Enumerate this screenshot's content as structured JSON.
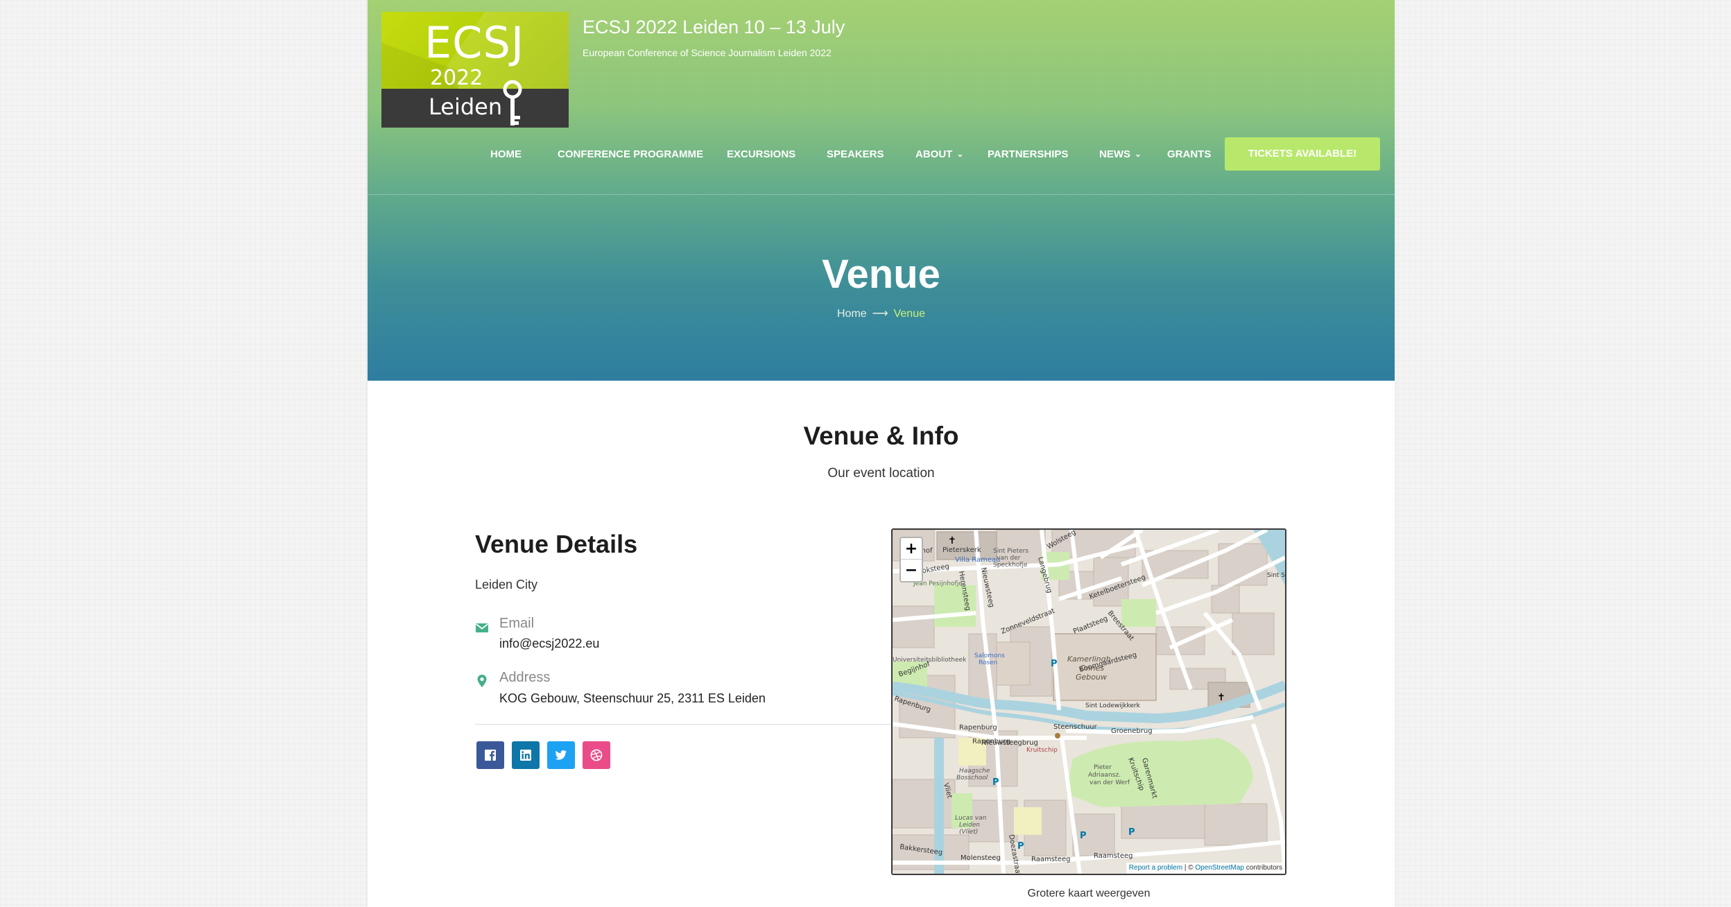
{
  "site": {
    "logo": {
      "line1": "ECSJ",
      "line2": "2022",
      "line3": "Leiden"
    },
    "title": "ECSJ 2022 Leiden 10 – 13 July",
    "tagline": "European Conference of Science Journalism Leiden 2022"
  },
  "nav": {
    "items": [
      {
        "label": "HOME",
        "dropdown": false
      },
      {
        "label": "CONFERENCE PROGRAMME",
        "dropdown": false
      },
      {
        "label": "EXCURSIONS",
        "dropdown": false
      },
      {
        "label": "SPEAKERS",
        "dropdown": false
      },
      {
        "label": "ABOUT",
        "dropdown": true
      },
      {
        "label": "PARTNERSHIPS",
        "dropdown": false
      },
      {
        "label": "NEWS",
        "dropdown": true
      },
      {
        "label": "GRANTS",
        "dropdown": false
      }
    ],
    "cta": "TICKETS AVAILABLE!"
  },
  "hero": {
    "title": "Venue",
    "breadcrumb": {
      "home": "Home",
      "current": "Venue"
    }
  },
  "section": {
    "title": "Venue & Info",
    "subtitle": "Our event location"
  },
  "details": {
    "title": "Venue Details",
    "venue": "Leiden City",
    "email_label": "Email",
    "email": "info@ecsj2022.eu",
    "address_label": "Address",
    "address": "KOG Gebouw, Steenschuur 25, 2311 ES Leiden"
  },
  "social": [
    "facebook-icon",
    "linkedin-icon",
    "twitter-icon",
    "dribbble-icon"
  ],
  "colors": {
    "accent": "#b8e86b",
    "breadcrumb_current": "#c8f07c",
    "icon_green": "#46b089",
    "facebook": "#3b5998",
    "linkedin": "#0e76a8",
    "twitter": "#1da1f2",
    "dribbble": "#ea4c89"
  },
  "map": {
    "zoom_in": "+",
    "zoom_out": "−",
    "attribution": {
      "report": "Report a problem",
      "sep": " | © ",
      "osm": "OpenStreetMap",
      "tail": " contributors"
    },
    "labels": {
      "pieterskerk": "Pieterskerk",
      "kerkhof": "kerkhof",
      "villa_rameau": "Villa Rameau",
      "sint_pieters": "Sint Pieters",
      "van_der": "van der",
      "speckhofje": "Speckhofje",
      "kloksteeg": "Kloksteeg",
      "jean_pesijnhofje": "Jean Pesijnhofje",
      "herensteeg": "Herensteeg",
      "nieuwsteeg": "Nieuwsteeg",
      "langebrug": "Langebrug",
      "wolsteeg": "Wolsteeg",
      "ketelboetersteeg": "Ketelboetersteeg",
      "sint_seb": "Sint Seb",
      "breestraat": "Breestraat",
      "zonneveldstraat": "Zonneveldstraat",
      "plaatsteeg": "Plaatsteeg",
      "boomgaardsteeg": "Boomgaardsteeg",
      "kamerlingh": "Kamerlingh",
      "onnes": "Onnes",
      "gebouw": "Gebouw",
      "salomons": "Salomons",
      "rosen": "Rosen",
      "universiteitsbibliotheek": "Universiteitsbibliotheek",
      "begijnhof": "Begijnhof",
      "rapenburg": "Rapenburg",
      "steenschuur": "Steenschuur",
      "groenebrug": "Groenebrug",
      "sint_lodewijkkerk": "Sint Lodewijkkerk",
      "nieuwsteegbrug": "Nieuwsteegbrug",
      "kruitschip": "Kruitschip",
      "kruitschip_st": "Kruitschip",
      "garenmarkt": "Garenmarkt",
      "pieter": "Pieter",
      "adriaansz": "Adriaansz.",
      "werf": "van der Werf",
      "haagsche": "Haagsche",
      "bosschool": "Bosschool",
      "lucas": "Lucas van",
      "leiden": "Leiden",
      "vliet_lbl": "(Vliet)",
      "vliet": "Vliet",
      "bakkersteeg": "Bakkersteeg",
      "molensteeg": "Molensteeg",
      "doezastraat": "Doezastraat",
      "raamsteeg": "Raamsteeg"
    }
  },
  "map_link": "Grotere kaart weergeven"
}
